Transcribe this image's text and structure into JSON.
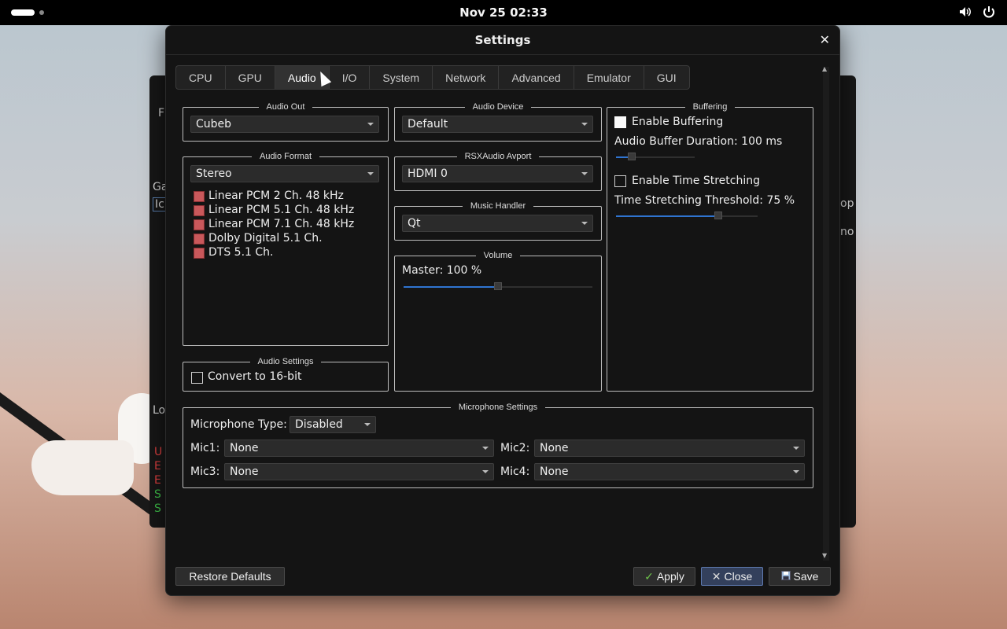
{
  "topbar": {
    "clock": "Nov 25  02:33"
  },
  "background_window": {
    "frags": [
      "F",
      "Ga",
      "Ic",
      "Lo",
      "U",
      "E",
      "E",
      "S",
      "S",
      "no",
      "op"
    ]
  },
  "dialog": {
    "title": "Settings",
    "close": "✕",
    "tabs": [
      "CPU",
      "GPU",
      "Audio",
      "I/O",
      "System",
      "Network",
      "Advanced",
      "Emulator",
      "GUI"
    ],
    "active_tab": "Audio",
    "audio_out": {
      "title": "Audio Out",
      "value": "Cubeb"
    },
    "audio_device": {
      "title": "Audio Device",
      "value": "Default"
    },
    "buffering": {
      "title": "Buffering",
      "enable_buffering": "Enable Buffering",
      "buffer_duration_label": "Audio Buffer Duration: 100 ms",
      "buffer_fraction": 0.2,
      "enable_time_stretching": "Enable Time Stretching",
      "time_stretch_label": "Time Stretching Threshold: 75 %",
      "time_stretch_fraction": 0.72
    },
    "audio_format": {
      "title": "Audio Format",
      "value": "Stereo",
      "items": [
        "Linear PCM 2 Ch. 48 kHz",
        "Linear PCM 5.1 Ch. 48 kHz",
        "Linear PCM 7.1 Ch. 48 kHz",
        "Dolby Digital 5.1 Ch.",
        "DTS 5.1 Ch."
      ]
    },
    "rsx_avport": {
      "title": "RSXAudio Avport",
      "value": "HDMI 0"
    },
    "music_handler": {
      "title": "Music Handler",
      "value": "Qt"
    },
    "volume": {
      "title": "Volume",
      "master_label": "Master: 100 %",
      "master_fraction": 0.5
    },
    "audio_settings": {
      "title": "Audio Settings",
      "convert": "Convert to 16-bit"
    },
    "microphone": {
      "title": "Microphone Settings",
      "type_label": "Microphone Type:",
      "type_value": "Disabled",
      "mic1_label": "Mic1:",
      "mic1_value": "None",
      "mic2_label": "Mic2:",
      "mic2_value": "None",
      "mic3_label": "Mic3:",
      "mic3_value": "None",
      "mic4_label": "Mic4:",
      "mic4_value": "None"
    },
    "buttons": {
      "restore": "Restore Defaults",
      "apply": "Apply",
      "close": "Close",
      "save": "Save"
    },
    "colors": {
      "accent": "#2f74d0",
      "checked_red": "#c9585b"
    }
  }
}
